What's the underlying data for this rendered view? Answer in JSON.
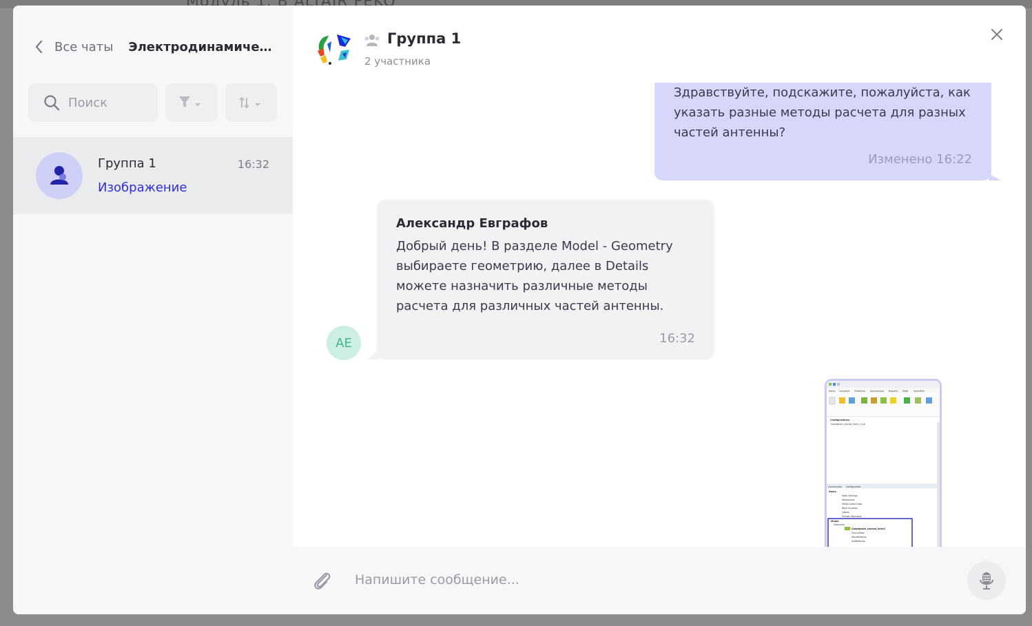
{
  "backdrop": {
    "text": "Модуль 1. В          ALTAIR FEKO"
  },
  "left": {
    "back_label": "Все чаты",
    "title": "Электродинамичес...",
    "search_placeholder": "Поиск",
    "chats": [
      {
        "name": "Группа 1",
        "time": "16:32",
        "preview": "Изображение"
      }
    ]
  },
  "conversation": {
    "title": "Группа 1",
    "subtitle": "2 участника"
  },
  "messages": {
    "outgoing": {
      "text": "Здравствуйте, подскажите, пожалуйста, как указать разные методы расчета для разных частей антенны?",
      "meta": "Изменено 16:22"
    },
    "incoming": {
      "author": "Александр Евграфов",
      "avatar_initials": "AE",
      "text": "Добрый день! В разделе Model - Geometry выбираете геометрию, далее в Details можете назначить различные методы расчета для различных частей антенны.",
      "time": "16:32"
    },
    "image": {
      "tabs": [
        "Home",
        "Construct",
        "Transform",
        "Source/Load",
        "Request",
        "Mesh",
        "Solve/Run"
      ],
      "tree_title": "Configurations",
      "tree_item": "Cassegrain_conical_horn1_0_ok",
      "panel_tabs": [
        "Construction",
        "Configuration"
      ],
      "items_title": "Items",
      "items": [
        "Mesh Settings",
        "Workplanes",
        "Field/Current Data",
        "Work Surfaces",
        "Cables",
        "Periodic Boundary"
      ],
      "model_title": "Model",
      "geometry_label": "Geometry",
      "model_node": "Cassegrain_conical_horn1",
      "model_children": [
        "ConicalHorn",
        "MainReflector",
        "SubReflector"
      ]
    }
  },
  "composer": {
    "placeholder": "Напишите сообщение..."
  },
  "colors": {
    "accent": "#2f2fd6",
    "outgoing_bubble": "#d6d7fa",
    "incoming_bubble": "#f2f2f4",
    "avatar_bg": "#cfd0f8"
  },
  "icons": [
    "back-icon",
    "search-icon",
    "filter-icon",
    "sort-icon",
    "group-icon",
    "close-icon",
    "attach-icon",
    "mic-icon",
    "user-icon"
  ]
}
